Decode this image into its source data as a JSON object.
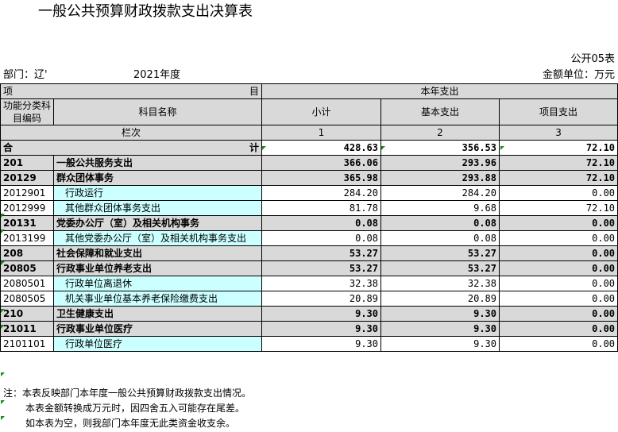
{
  "title": "一般公共预算财政拨款支出决算表",
  "form_no": "公开05表",
  "dept": "部门：辽'",
  "year": "2021年度",
  "unit": "金额单位：万元",
  "header": {
    "item_left": "项",
    "item_right": "目",
    "year_exp": "本年支出",
    "code": "功能分类科目编码",
    "name": "科目名称",
    "subtotal": "小计",
    "basic": "基本支出",
    "project": "项目支出",
    "col_index": "栏次",
    "col1": "1",
    "col2": "2",
    "col3": "3"
  },
  "total": {
    "left": "合",
    "right": "计",
    "subtotal": "428.63",
    "basic": "356.53",
    "project": "72.10"
  },
  "rows": [
    {
      "code": "201",
      "name": "一般公共服务支出",
      "subtotal": "366.06",
      "basic": "293.96",
      "project": "72.10",
      "level": "gray"
    },
    {
      "code": "20129",
      "name": "群众团体事务",
      "subtotal": "365.98",
      "basic": "293.88",
      "project": "72.10",
      "level": "gray"
    },
    {
      "code": "2012901",
      "name": "行政运行",
      "subtotal": "284.20",
      "basic": "284.20",
      "project": "0.00",
      "level": "leaf"
    },
    {
      "code": "2012999",
      "name": "其他群众团体事务支出",
      "subtotal": "81.78",
      "basic": "9.68",
      "project": "72.10",
      "level": "leaf"
    },
    {
      "code": "20131",
      "name": "党委办公厅（室）及相关机构事务",
      "subtotal": "0.08",
      "basic": "0.08",
      "project": "0.00",
      "level": "gray"
    },
    {
      "code": "2013199",
      "name": "其他党委办公厅（室）及相关机构事务支出",
      "subtotal": "0.08",
      "basic": "0.08",
      "project": "0.00",
      "level": "leaf"
    },
    {
      "code": "208",
      "name": "社会保障和就业支出",
      "subtotal": "53.27",
      "basic": "53.27",
      "project": "0.00",
      "level": "gray"
    },
    {
      "code": "20805",
      "name": "行政事业单位养老支出",
      "subtotal": "53.27",
      "basic": "53.27",
      "project": "0.00",
      "level": "gray"
    },
    {
      "code": "2080501",
      "name": "行政单位离退休",
      "subtotal": "32.38",
      "basic": "32.38",
      "project": "0.00",
      "level": "leaf"
    },
    {
      "code": "2080505",
      "name": "机关事业单位基本养老保险缴费支出",
      "subtotal": "20.89",
      "basic": "20.89",
      "project": "0.00",
      "level": "leaf"
    },
    {
      "code": "210",
      "name": "卫生健康支出",
      "subtotal": "9.30",
      "basic": "9.30",
      "project": "0.00",
      "level": "gray"
    },
    {
      "code": "21011",
      "name": "行政事业单位医疗",
      "subtotal": "9.30",
      "basic": "9.30",
      "project": "0.00",
      "level": "gray"
    },
    {
      "code": "2101101",
      "name": "行政单位医疗",
      "subtotal": "9.30",
      "basic": "9.30",
      "project": "0.00",
      "level": "leaf"
    }
  ],
  "notes": [
    "注：本表反映部门本年度一般公共预算财政拨款支出情况。",
    "本表金额转换成万元时，因四舍五入可能存在尾差。",
    "如本表为空，则我部门本年度无此类资金收支余。"
  ],
  "colors": {
    "header_gray": "#d9d9d9",
    "leaf_cyan": "#ccffff",
    "marker_green": "#1b8a1b"
  }
}
